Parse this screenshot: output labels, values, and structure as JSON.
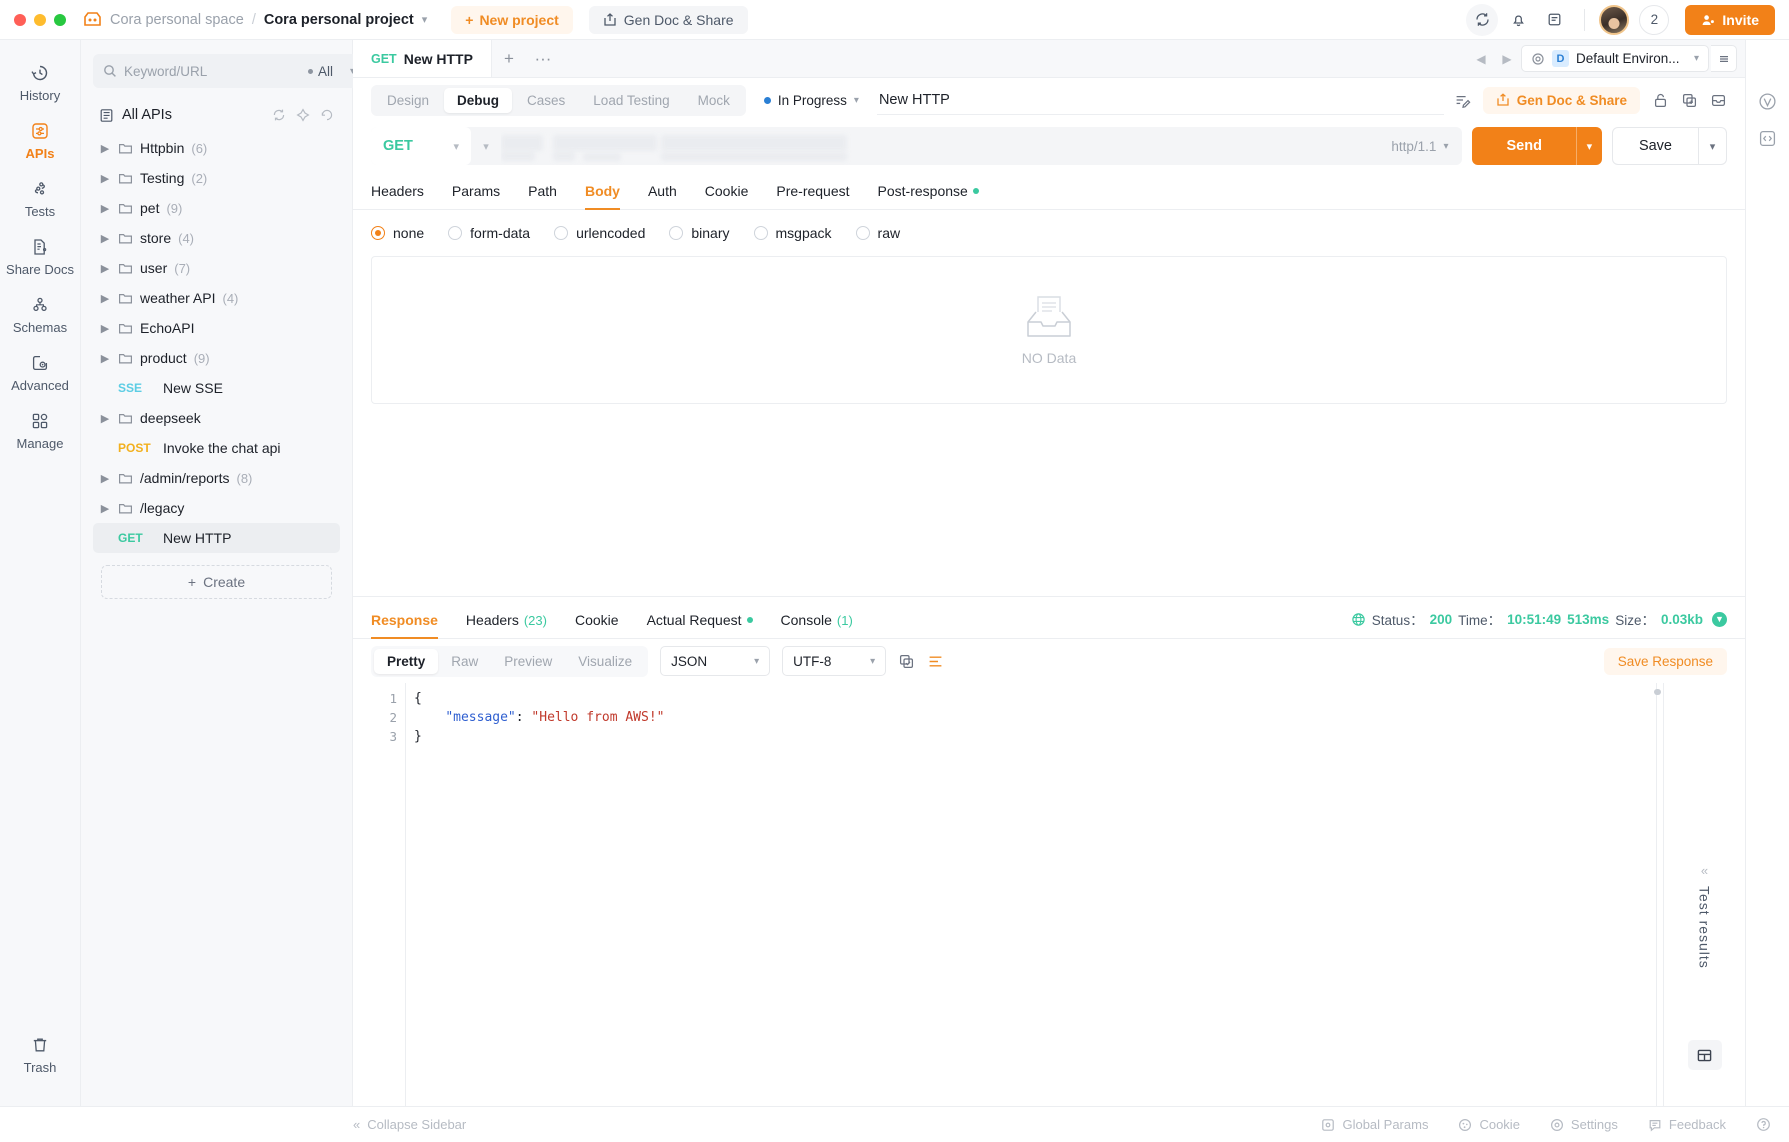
{
  "topbar": {
    "workspace": "Cora personal space",
    "separator": "/",
    "project": "Cora personal project",
    "new_project": "New project",
    "gen_doc_share": "Gen Doc & Share",
    "member_count": "2",
    "invite": "Invite"
  },
  "rail": {
    "items": [
      {
        "label": "History",
        "icon": "history-icon",
        "active": false
      },
      {
        "label": "APIs",
        "icon": "apis-icon",
        "active": true
      },
      {
        "label": "Tests",
        "icon": "tests-icon",
        "active": false
      },
      {
        "label": "Share Docs",
        "icon": "share-docs-icon",
        "active": false
      },
      {
        "label": "Schemas",
        "icon": "schemas-icon",
        "active": false
      },
      {
        "label": "Advanced",
        "icon": "advanced-icon",
        "active": false
      },
      {
        "label": "Manage",
        "icon": "manage-icon",
        "active": false
      }
    ],
    "trash": "Trash"
  },
  "tree": {
    "search_placeholder": "Keyword/URL",
    "filter_label": "All",
    "add_button": "+",
    "root": "All APIs",
    "nodes": [
      {
        "type": "folder",
        "label": "Httpbin",
        "count": "(6)"
      },
      {
        "type": "folder",
        "label": "Testing",
        "count": "(2)"
      },
      {
        "type": "folder",
        "label": "pet",
        "count": "(9)"
      },
      {
        "type": "folder",
        "label": "store",
        "count": "(4)"
      },
      {
        "type": "folder",
        "label": "user",
        "count": "(7)"
      },
      {
        "type": "folder",
        "label": "weather API",
        "count": "(4)"
      },
      {
        "type": "folder",
        "label": "EchoAPI",
        "count": ""
      },
      {
        "type": "folder",
        "label": "product",
        "count": "(9)"
      },
      {
        "type": "api",
        "method": "SSE",
        "label": "New SSE"
      },
      {
        "type": "folder",
        "label": "deepseek",
        "count": ""
      },
      {
        "type": "api",
        "method": "POST",
        "label": "Invoke the chat api"
      },
      {
        "type": "folder",
        "label": "/admin/reports",
        "count": "(8)"
      },
      {
        "type": "folder",
        "label": "/legacy",
        "count": ""
      },
      {
        "type": "api",
        "method": "GET",
        "label": "New HTTP",
        "selected": true
      }
    ],
    "create": "Create"
  },
  "tabs": {
    "open": [
      {
        "method": "GET",
        "title": "New HTTP",
        "active": true
      }
    ],
    "add": "+",
    "more": "···",
    "environment": "Default Environ...",
    "env_badge": "D"
  },
  "modebar": {
    "modes": [
      {
        "label": "Design",
        "active": false
      },
      {
        "label": "Debug",
        "active": true
      },
      {
        "label": "Cases",
        "active": false
      },
      {
        "label": "Load Testing",
        "active": false
      },
      {
        "label": "Mock",
        "active": false
      }
    ],
    "status": "In Progress",
    "name_value": "New HTTP",
    "gen_doc_share": "Gen Doc & Share"
  },
  "urlbar": {
    "method": "GET",
    "url_value": "",
    "http_version": "http/1.1",
    "send": "Send",
    "save": "Save"
  },
  "request_tabs": [
    {
      "label": "Headers",
      "active": false,
      "dot": false
    },
    {
      "label": "Params",
      "active": false,
      "dot": false
    },
    {
      "label": "Path",
      "active": false,
      "dot": false
    },
    {
      "label": "Body",
      "active": true,
      "dot": false
    },
    {
      "label": "Auth",
      "active": false,
      "dot": false
    },
    {
      "label": "Cookie",
      "active": false,
      "dot": false
    },
    {
      "label": "Pre-request",
      "active": false,
      "dot": false
    },
    {
      "label": "Post-response",
      "active": false,
      "dot": true
    }
  ],
  "body_types": [
    {
      "label": "none",
      "selected": true
    },
    {
      "label": "form-data",
      "selected": false
    },
    {
      "label": "urlencoded",
      "selected": false
    },
    {
      "label": "binary",
      "selected": false
    },
    {
      "label": "msgpack",
      "selected": false
    },
    {
      "label": "raw",
      "selected": false
    }
  ],
  "body_empty": "NO Data",
  "response": {
    "tabs": [
      {
        "label": "Response",
        "count": "",
        "active": true,
        "dot": false
      },
      {
        "label": "Headers",
        "count": "(23)",
        "active": false,
        "dot": false
      },
      {
        "label": "Cookie",
        "count": "",
        "active": false,
        "dot": false
      },
      {
        "label": "Actual Request",
        "count": "",
        "active": false,
        "dot": true
      },
      {
        "label": "Console",
        "count": "(1)",
        "active": false,
        "dot": false
      }
    ],
    "status_label": "Status：",
    "status_value": "200",
    "time_label": "Time：",
    "time_value": "10:51:49",
    "duration_value": "513ms",
    "size_label": "Size：",
    "size_value": "0.03kb",
    "view_modes": [
      {
        "label": "Pretty",
        "active": true
      },
      {
        "label": "Raw",
        "active": false
      },
      {
        "label": "Preview",
        "active": false
      },
      {
        "label": "Visualize",
        "active": false
      }
    ],
    "format": "JSON",
    "encoding": "UTF-8",
    "save_response": "Save Response",
    "line_numbers": [
      "1",
      "2",
      "3"
    ],
    "code_lines": [
      {
        "parts": [
          {
            "t": "{",
            "c": "pun"
          }
        ]
      },
      {
        "parts": [
          {
            "t": "    ",
            "c": "pun"
          },
          {
            "t": "\"message\"",
            "c": "key"
          },
          {
            "t": ": ",
            "c": "pun"
          },
          {
            "t": "\"Hello from AWS!\"",
            "c": "str"
          }
        ]
      },
      {
        "parts": [
          {
            "t": "}",
            "c": "pun"
          }
        ]
      }
    ],
    "test_results": "Test results"
  },
  "footer": {
    "collapse_sidebar": "Collapse Sidebar",
    "items": [
      {
        "label": "Global Params",
        "icon": "global-params-icon"
      },
      {
        "label": "Cookie",
        "icon": "cookie-icon"
      },
      {
        "label": "Settings",
        "icon": "settings-icon"
      },
      {
        "label": "Feedback",
        "icon": "feedback-icon"
      }
    ]
  },
  "colors": {
    "accent": "#f28118",
    "method_get": "#3bc9a0",
    "method_post": "#f2b01e",
    "method_sse": "#5ccde4",
    "status_ok": "#3bc9a0"
  }
}
